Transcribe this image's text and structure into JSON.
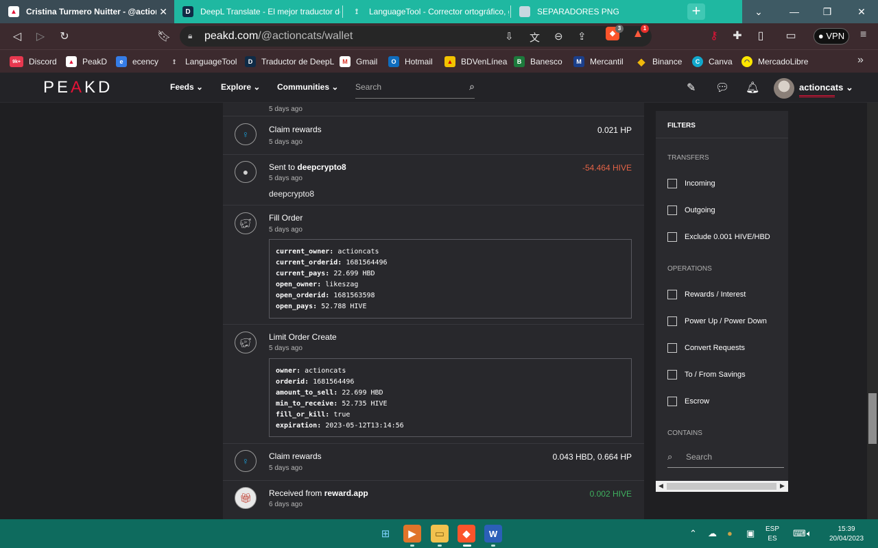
{
  "browser": {
    "tabs": [
      {
        "title": "Cristina Turmero Nuitter - @actioncats",
        "active": true
      },
      {
        "title": "DeepL Translate - El mejor traductor del mundo"
      },
      {
        "title": "LanguageTool - Corrector ortográfico, gramatical"
      },
      {
        "title": "SEPARADORES PNG"
      }
    ],
    "tab_close": "✕",
    "new_tab": "+",
    "url_domain": "peakd.com",
    "url_path": "/@actioncats/wallet",
    "brave_count": "3",
    "rewards_count": "1",
    "vpn_label": "VPN",
    "bookmarks": [
      {
        "label": "Discord",
        "badge": "9k+"
      },
      {
        "label": "PeakD"
      },
      {
        "label": "ecency"
      },
      {
        "label": "LanguageTool"
      },
      {
        "label": "Traductor de DeepL"
      },
      {
        "label": "Gmail"
      },
      {
        "label": "Hotmail"
      },
      {
        "label": "BDVenLínea"
      },
      {
        "label": "Banesco"
      },
      {
        "label": "Mercantil"
      },
      {
        "label": "Binance"
      },
      {
        "label": "Canva"
      },
      {
        "label": "MercadoLibre"
      }
    ],
    "bookmarks_more": "»"
  },
  "header": {
    "logo_left": "PE",
    "logo_a": "A",
    "logo_right": "KD",
    "nav": [
      {
        "label": "Feeds"
      },
      {
        "label": "Explore"
      },
      {
        "label": "Communities"
      }
    ],
    "search_placeholder": "Search",
    "username": "actioncats"
  },
  "feed": {
    "top_partial_time": "5 days ago",
    "entries": [
      {
        "title": "Claim rewards",
        "time": "5 days ago",
        "amount": "0.021 HP"
      },
      {
        "title_prefix": "Sent to ",
        "title_user": "deepcrypto8",
        "time": "5 days ago",
        "amount": "-54.464 HIVE",
        "memo": "deepcrypto8"
      },
      {
        "title": "Fill Order",
        "time": "5 days ago",
        "details": [
          {
            "key": "current_owner:",
            "value": "actioncats"
          },
          {
            "key": "current_orderid:",
            "value": "1681564496"
          },
          {
            "key": "current_pays:",
            "value": "22.699 HBD"
          },
          {
            "key": "open_owner:",
            "value": "likeszag"
          },
          {
            "key": "open_orderid:",
            "value": "1681563598"
          },
          {
            "key": "open_pays:",
            "value": "52.788 HIVE"
          }
        ]
      },
      {
        "title": "Limit Order Create",
        "time": "5 days ago",
        "details": [
          {
            "key": "owner:",
            "value": "actioncats"
          },
          {
            "key": "orderid:",
            "value": "1681564496"
          },
          {
            "key": "amount_to_sell:",
            "value": "22.699 HBD"
          },
          {
            "key": "min_to_receive:",
            "value": "52.735 HIVE"
          },
          {
            "key": "fill_or_kill:",
            "value": "true"
          },
          {
            "key": "expiration:",
            "value": "2023-05-12T13:14:56"
          }
        ]
      },
      {
        "title": "Claim rewards",
        "time": "5 days ago",
        "amount": "0.043 HBD, 0.664 HP"
      },
      {
        "title_prefix": "Received from ",
        "title_user": "reward.app",
        "time": "6 days ago",
        "amount": "0.002 HIVE"
      }
    ]
  },
  "filters": {
    "heading": "FILTERS",
    "transfers_label": "TRANSFERS",
    "transfers": [
      "Incoming",
      "Outgoing",
      "Exclude 0.001 HIVE/HBD"
    ],
    "operations_label": "OPERATIONS",
    "operations": [
      "Rewards / Interest",
      "Power Up / Power Down",
      "Convert Requests",
      "To / From Savings",
      "Escrow"
    ],
    "contains_label": "CONTAINS",
    "search_placeholder": "Search"
  },
  "taskbar": {
    "lang_top": "ESP",
    "lang_bottom": "ES",
    "time": "15:39",
    "date": "20/04/2023"
  },
  "colors": {
    "accent_red": "#e31337",
    "negative": "#e36346",
    "positive": "#3fb15f",
    "tab_teal": "#1fb8a1"
  }
}
